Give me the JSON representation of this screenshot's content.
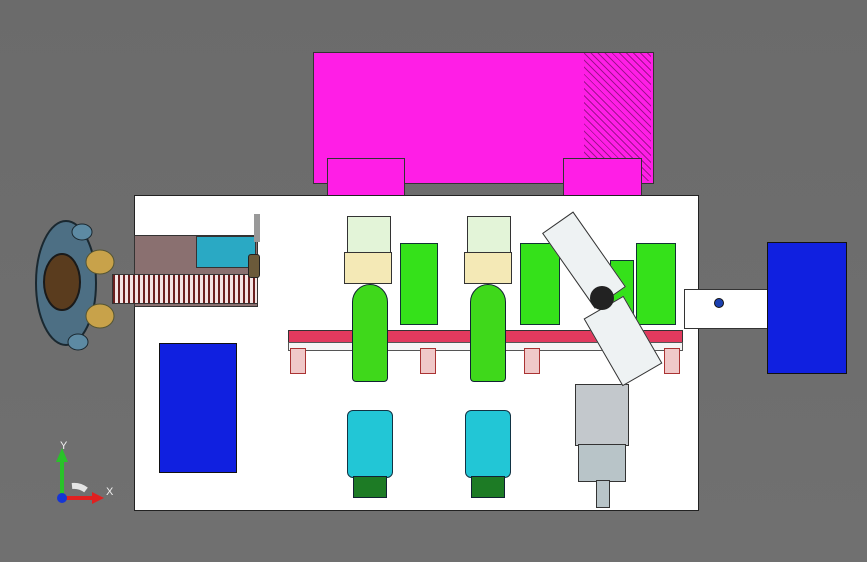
{
  "viewport": {
    "background": "#6e6e6e",
    "view_type": "CAD assembly - top view"
  },
  "colors": {
    "cabinet": "#ff1ee6",
    "blue_box": "#1020e0",
    "base": "#ffffff",
    "green": "#35e11a",
    "cyan_motor": "#22c6d6",
    "rail": "#e23a5e"
  },
  "axis_triad": {
    "x_label": "X",
    "y_label": "Y",
    "icon": "coordinate-triad-icon"
  }
}
